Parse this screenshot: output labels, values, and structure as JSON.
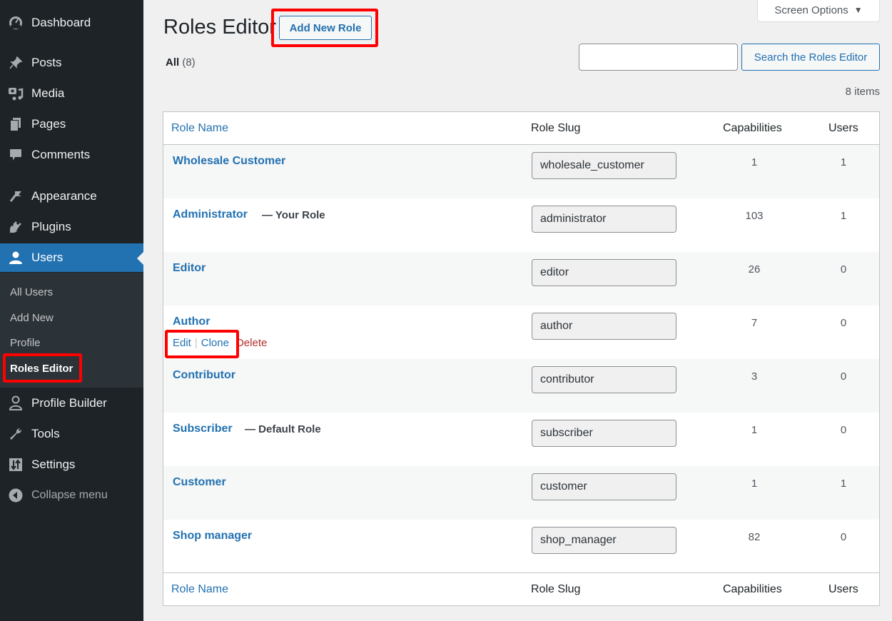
{
  "sidebar": {
    "items": [
      {
        "label": "Dashboard",
        "icon": "dashboard-icon"
      },
      {
        "label": "Posts",
        "icon": "pin-icon"
      },
      {
        "label": "Media",
        "icon": "media-icon"
      },
      {
        "label": "Pages",
        "icon": "pages-icon"
      },
      {
        "label": "Comments",
        "icon": "comment-icon"
      },
      {
        "label": "Appearance",
        "icon": "brush-icon"
      },
      {
        "label": "Plugins",
        "icon": "plug-icon"
      },
      {
        "label": "Users",
        "icon": "user-icon",
        "active": true
      },
      {
        "label": "Profile Builder",
        "icon": "person-outline-icon"
      },
      {
        "label": "Tools",
        "icon": "wrench-icon"
      },
      {
        "label": "Settings",
        "icon": "sliders-icon"
      }
    ],
    "submenu": [
      "All Users",
      "Add New",
      "Profile",
      "Roles Editor"
    ],
    "collapse_label": "Collapse menu"
  },
  "header": {
    "title": "Roles Editor",
    "add_new_label": "Add New Role",
    "screen_options_label": "Screen Options",
    "filter_all_label": "All",
    "filter_all_count": "(8)",
    "search_value": "",
    "search_button_label": "Search the Roles Editor",
    "items_count": "8 items"
  },
  "table": {
    "columns": [
      "Role Name",
      "Role Slug",
      "Capabilities",
      "Users"
    ],
    "rows": [
      {
        "name": "Wholesale Customer",
        "note": "",
        "slug": "wholesale_customer",
        "capabilities": "1",
        "users": "1"
      },
      {
        "name": "Administrator",
        "note": "— Your Role",
        "slug": "administrator",
        "capabilities": "103",
        "users": "1"
      },
      {
        "name": "Editor",
        "note": "",
        "slug": "editor",
        "capabilities": "26",
        "users": "0"
      },
      {
        "name": "Author",
        "note": "",
        "slug": "author",
        "capabilities": "7",
        "users": "0"
      },
      {
        "name": "Contributor",
        "note": "",
        "slug": "contributor",
        "capabilities": "3",
        "users": "0"
      },
      {
        "name": "Subscriber",
        "note": "— Default Role",
        "slug": "subscriber",
        "capabilities": "1",
        "users": "0"
      },
      {
        "name": "Customer",
        "note": "",
        "slug": "customer",
        "capabilities": "1",
        "users": "1"
      },
      {
        "name": "Shop manager",
        "note": "",
        "slug": "shop_manager",
        "capabilities": "82",
        "users": "0"
      }
    ],
    "row_actions": {
      "edit": "Edit",
      "clone": "Clone",
      "delete": "Delete"
    }
  },
  "colors": {
    "accent": "#2271b1",
    "sidebar_bg": "#1d2327",
    "delete": "#b32d2e",
    "highlight": "#ff0000"
  }
}
